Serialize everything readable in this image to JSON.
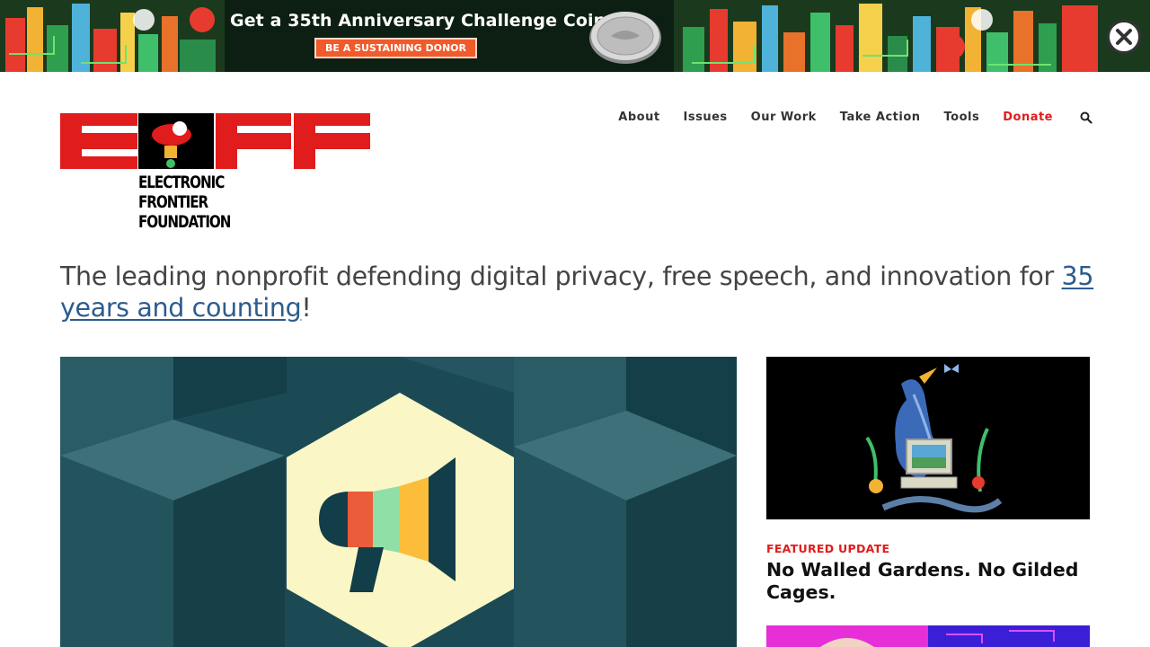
{
  "banner": {
    "title": "Get a 35th Anniversary Challenge Coin",
    "cta_label": "BE A SUSTAINING DONOR"
  },
  "logo": {
    "wordmark_lines": [
      "ELECTRONIC",
      "FRONTIER",
      "FOUNDATION"
    ]
  },
  "nav": {
    "items": [
      "About",
      "Issues",
      "Our Work",
      "Take Action",
      "Tools"
    ],
    "donate_label": "Donate"
  },
  "tagline": {
    "text": "The leading nonprofit defending digital privacy, free speech, and innovation for ",
    "link_text": "35 years and counting",
    "suffix": "!"
  },
  "feature": {
    "kicker": "FEATURED UPDATE",
    "title": "No Walled Gardens. No Gilded Cages."
  },
  "colors": {
    "brand_red": "#e11c1c",
    "link_blue": "#2d5c8e",
    "hero_bg": "#1b4a55",
    "hero_hex": "#fbf6c6",
    "banner_cta": "#f15a2b"
  }
}
